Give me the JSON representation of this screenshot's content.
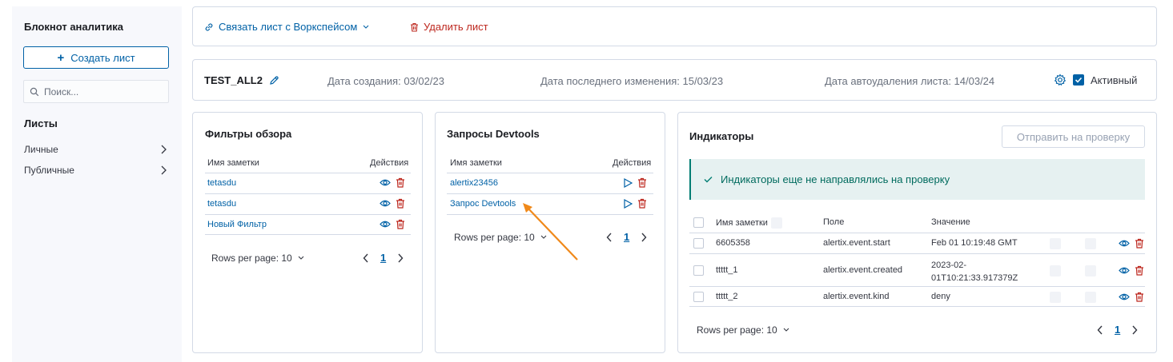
{
  "sidebar": {
    "title": "Блокнот аналитика",
    "create_button": "Создать лист",
    "search_placeholder": "Поиск...",
    "sheets_heading": "Листы",
    "items": [
      {
        "label": "Личные"
      },
      {
        "label": "Публичные"
      }
    ]
  },
  "topbar": {
    "link_workspace": "Связать лист с Воркспейсом",
    "delete_sheet": "Удалить лист"
  },
  "sheet": {
    "name": "TEST_ALL2",
    "created": "Дата создания: 03/02/23",
    "modified": "Дата последнего изменения: 15/03/23",
    "autodelete": "Дата автоудаления листа: 14/03/24",
    "active_label": "Активный",
    "active": true
  },
  "filters": {
    "title": "Фильтры обзора",
    "col_name": "Имя заметки",
    "col_actions": "Действия",
    "rows": [
      "tetasdu",
      "tetasdu",
      "Новый Фильтр"
    ],
    "rows_per_page": "Rows per page: 10",
    "page": "1"
  },
  "devtools": {
    "title": "Запросы Devtools",
    "col_name": "Имя заметки",
    "col_actions": "Действия",
    "rows": [
      "alertix23456",
      "Запрос Devtools"
    ],
    "rows_per_page": "Rows per page: 10",
    "page": "1"
  },
  "indicators": {
    "title": "Индикаторы",
    "send_button": "Отправить на проверку",
    "callout": "Индикаторы еще не направлялись на проверку",
    "col_name": "Имя заметки",
    "col_field": "Поле",
    "col_value": "Значение",
    "rows": [
      {
        "name": "6605358",
        "field": "alertix.event.start",
        "value": "Feb 01 10:19:48 GMT"
      },
      {
        "name": "ttttt_1",
        "field": "alertix.event.created",
        "value": "2023-02-01T10:21:33.917379Z"
      },
      {
        "name": "ttttt_2",
        "field": "alertix.event.kind",
        "value": "deny"
      }
    ],
    "value_line1": "2023-02-",
    "value_line2": "01T10:21:33.917379Z",
    "rows_per_page": "Rows per page: 10",
    "page": "1"
  },
  "colors": {
    "primary": "#0061a6",
    "danger": "#bd271e",
    "success_bg": "#e6f1f1",
    "annotation_arrow": "#f0891a"
  }
}
